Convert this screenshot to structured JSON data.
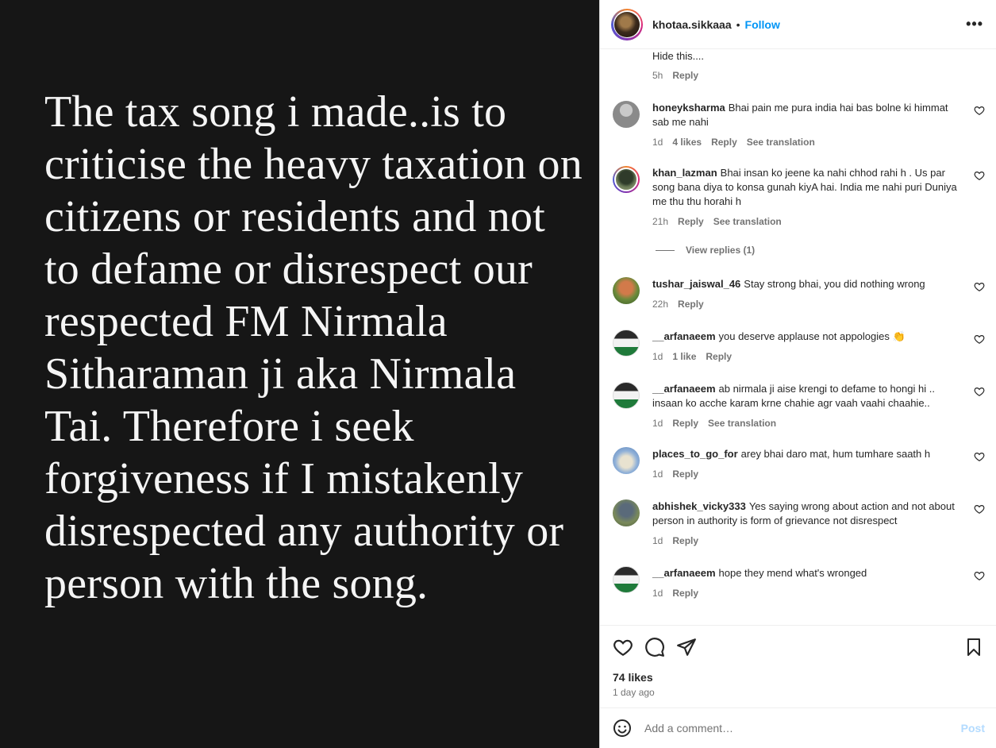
{
  "post": {
    "text": "The tax song i made..is to criticise the heavy taxation on citizens or residents and not to defame or disrespect our respected FM Nirmala Sitharaman ji aka Nirmala Tai. Therefore i seek forgiveness if I mistakenly disrespected any authority or person with the song."
  },
  "header": {
    "username": "khotaa.sikkaaa",
    "dot": "•",
    "follow_label": "Follow",
    "more_label": "•••"
  },
  "comments": [
    {
      "username": "",
      "text": "Hide this....",
      "time": "5h",
      "likes": "",
      "reply": "Reply",
      "translate": ""
    },
    {
      "username": "honeyksharma",
      "text": "Bhai pain me pura india hai bas bolne ki himmat sab me nahi",
      "time": "1d",
      "likes": "4 likes",
      "reply": "Reply",
      "translate": "See translation"
    },
    {
      "username": "khan_lazman",
      "text": "Bhai insan ko jeene ka nahi chhod rahi h . Us par song bana diya to konsa gunah kiyA hai. India me nahi puri Duniya me thu thu horahi h",
      "time": "21h",
      "likes": "",
      "reply": "Reply",
      "translate": "See translation"
    },
    {
      "username": "tushar_jaiswal_46",
      "text": "Stay strong bhai, you did nothing wrong",
      "time": "22h",
      "likes": "",
      "reply": "Reply",
      "translate": ""
    },
    {
      "username": "__arfanaeem",
      "text": "you deserve applause not appologies 👏",
      "time": "1d",
      "likes": "1 like",
      "reply": "Reply",
      "translate": ""
    },
    {
      "username": "__arfanaeem",
      "text": "ab nirmala ji aise krengi to defame to hongi hi .. insaan ko acche karam krne chahie agr vaah vaahi chaahie..",
      "time": "1d",
      "likes": "",
      "reply": "Reply",
      "translate": "See translation"
    },
    {
      "username": "places_to_go_for",
      "text": "arey bhai daro mat, hum tumhare saath h",
      "time": "1d",
      "likes": "",
      "reply": "Reply",
      "translate": ""
    },
    {
      "username": "abhishek_vicky333",
      "text": "Yes saying wrong about action and not about person in authority is form of grievance not disrespect",
      "time": "1d",
      "likes": "",
      "reply": "Reply",
      "translate": ""
    },
    {
      "username": "__arfanaeem",
      "text": "hope they mend what's wronged",
      "time": "1d",
      "likes": "",
      "reply": "Reply",
      "translate": ""
    }
  ],
  "view_replies": "View replies (1)",
  "actions": {
    "likes": "74 likes",
    "time": "1 day ago"
  },
  "add_comment": {
    "placeholder": "Add a comment…",
    "post_label": "Post"
  },
  "colors": {
    "accent": "#0095f6",
    "post_bg": "#161616"
  }
}
